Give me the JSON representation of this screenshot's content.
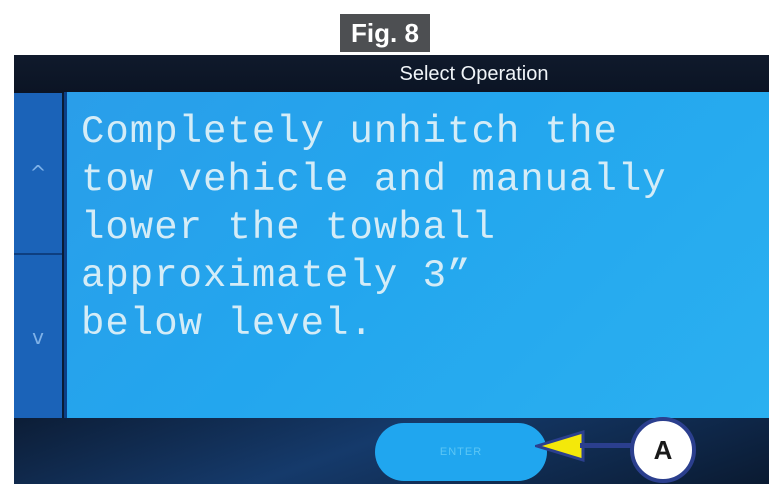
{
  "figure_label": "Fig. 8",
  "screen": {
    "title": "Select Operation",
    "scroll_up_symbol": "^",
    "scroll_down_symbol": "v",
    "message": "Completely unhitch the\ntow vehicle and manually\nlower the towball\napproximately 3”\nbelow level.",
    "enter_label": "ENTER"
  },
  "callout": {
    "label": "A"
  },
  "colors": {
    "panel": "#23a6ee",
    "side_buttons": "#1b63b8",
    "callout_arrow": "#f4e80a",
    "callout_border": "#2b3f8e"
  }
}
